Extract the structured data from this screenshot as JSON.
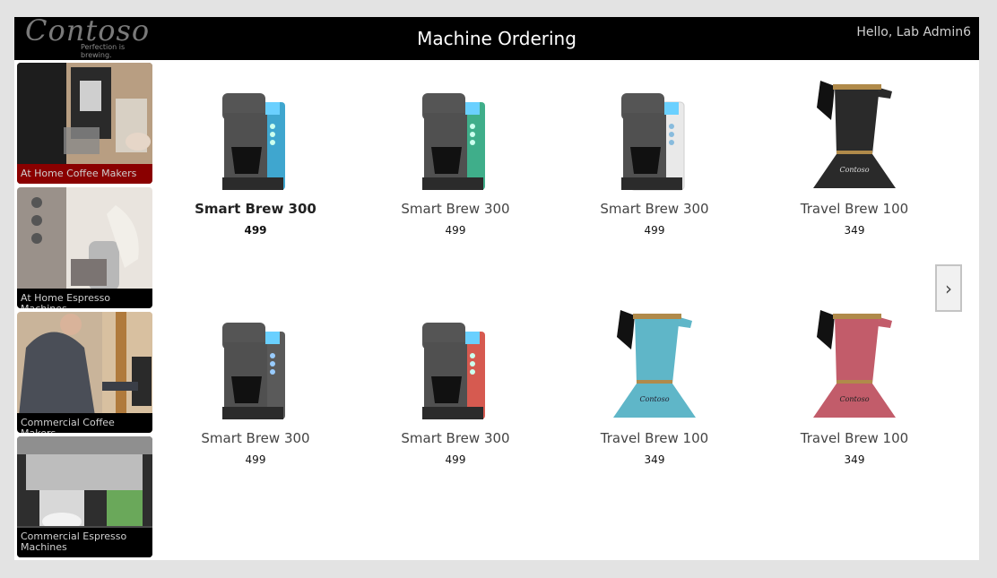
{
  "header": {
    "logo_text": "Contoso",
    "logo_tagline": "Perfection is brewing.",
    "title": "Machine Ordering",
    "greeting": "Hello, Lab Admin6"
  },
  "sidebar": {
    "items": [
      {
        "label": "At Home Coffee Makers",
        "active": true
      },
      {
        "label": "At Home Espresso Machines",
        "active": false
      },
      {
        "label": "Commercial Coffee Makers",
        "active": false
      },
      {
        "label": "Commercial Espresso Machines",
        "active": false
      }
    ]
  },
  "products": [
    {
      "name": "Smart Brew 300",
      "price": "499",
      "color": "#3fa6cf",
      "kind": "brewer",
      "selected": true
    },
    {
      "name": "Smart Brew 300",
      "price": "499",
      "color": "#3fae8a",
      "kind": "brewer",
      "selected": false
    },
    {
      "name": "Smart Brew 300",
      "price": "499",
      "color": "#e9e9e9",
      "kind": "brewer",
      "selected": false
    },
    {
      "name": "Travel Brew 100",
      "price": "349",
      "color": "#2a2a2a",
      "kind": "kettle",
      "selected": false
    },
    {
      "name": "Smart Brew 300",
      "price": "499",
      "color": "#5a5a5a",
      "kind": "brewer",
      "selected": false
    },
    {
      "name": "Smart Brew 300",
      "price": "499",
      "color": "#d65a50",
      "kind": "brewer",
      "selected": false
    },
    {
      "name": "Travel Brew 100",
      "price": "349",
      "color": "#5fb6c8",
      "kind": "kettle",
      "selected": false
    },
    {
      "name": "Travel Brew 100",
      "price": "349",
      "color": "#c25c6a",
      "kind": "kettle",
      "selected": false
    }
  ],
  "pager": {
    "next_glyph": "›"
  }
}
